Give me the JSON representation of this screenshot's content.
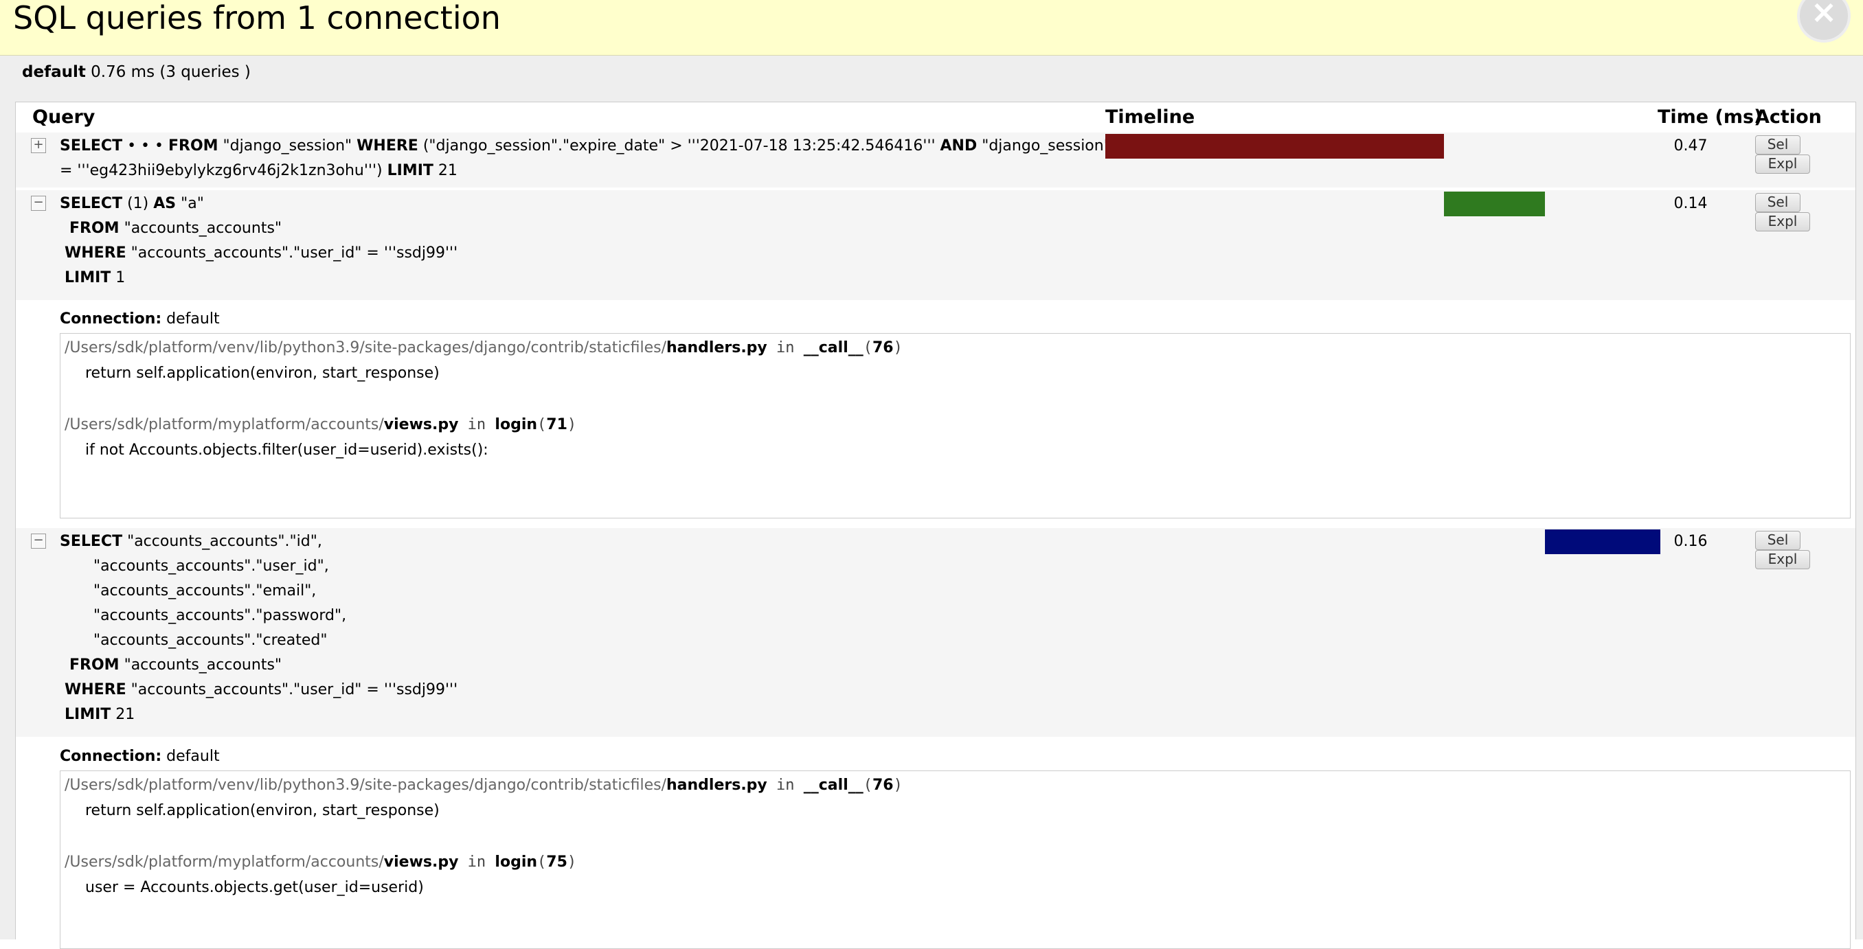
{
  "header": {
    "title": "SQL queries from 1 connection",
    "close_glyph": "×"
  },
  "summary": {
    "alias": "default",
    "time": "0.76 ms",
    "count": "(3 queries )"
  },
  "columns": {
    "query": "Query",
    "timeline": "Timeline",
    "time": "Time (ms)",
    "action": "Action"
  },
  "queries": [
    {
      "toggle": "+",
      "lines": [
        "<b>SELECT</b> • • • <b>FROM</b> \"django_session\" <b>WHERE</b> (\"django_session\".\"expire_date\" > '''2021-07-18 13:25:42.546416''' <b>AND</b> \"django_session\".\"session_key\"",
        "= '''eg423hii9ebylykzg6rv46j2k1zn3ohu''') <b>LIMIT</b> 21"
      ],
      "time": "0.47",
      "timeline_share": 0.6184,
      "bar_color": "#7a1212",
      "actions": [
        "Sel",
        "Expl"
      ]
    },
    {
      "toggle": "−",
      "lines": [
        "<b>SELECT</b> (1) <b>AS</b> \"a\"",
        "  <b>FROM</b> \"accounts_accounts\"",
        " <b>WHERE</b> \"accounts_accounts\".\"user_id\" = '''ssdj99'''",
        " <b>LIMIT</b> 1"
      ],
      "time": "0.14",
      "timeline_share": 0.1842,
      "bar_color": "#2f7a1f",
      "actions": [
        "Sel",
        "Expl"
      ],
      "connection_label": "Connection:",
      "connection": "default",
      "trace": [
        {
          "path": "/Users/sdk/platform/venv/lib/python3.9/site-packages/django/contrib/staticfiles/",
          "file": "handlers.py",
          "in": "in",
          "func": "__call__",
          "line": "76",
          "code": "return self.application(environ, start_response)"
        },
        {
          "path": "/Users/sdk/platform/myplatform/accounts/",
          "file": "views.py",
          "in": "in",
          "func": "login",
          "line": "71",
          "code": "if not Accounts.objects.filter(user_id=userid).exists():"
        }
      ]
    },
    {
      "toggle": "−",
      "lines": [
        "<b>SELECT</b> \"accounts_accounts\".\"id\",",
        "       \"accounts_accounts\".\"user_id\",",
        "       \"accounts_accounts\".\"email\",",
        "       \"accounts_accounts\".\"password\",",
        "       \"accounts_accounts\".\"created\"",
        "  <b>FROM</b> \"accounts_accounts\"",
        " <b>WHERE</b> \"accounts_accounts\".\"user_id\" = '''ssdj99'''",
        " <b>LIMIT</b> 21"
      ],
      "time": "0.16",
      "timeline_share": 0.2105,
      "bar_color": "#000a7a",
      "actions": [
        "Sel",
        "Expl"
      ],
      "connection_label": "Connection:",
      "connection": "default",
      "trace": [
        {
          "path": "/Users/sdk/platform/venv/lib/python3.9/site-packages/django/contrib/staticfiles/",
          "file": "handlers.py",
          "in": "in",
          "func": "__call__",
          "line": "76",
          "code": "return self.application(environ, start_response)"
        },
        {
          "path": "/Users/sdk/platform/myplatform/accounts/",
          "file": "views.py",
          "in": "in",
          "func": "login",
          "line": "75",
          "code": "user = Accounts.objects.get(user_id=userid)"
        }
      ]
    }
  ]
}
